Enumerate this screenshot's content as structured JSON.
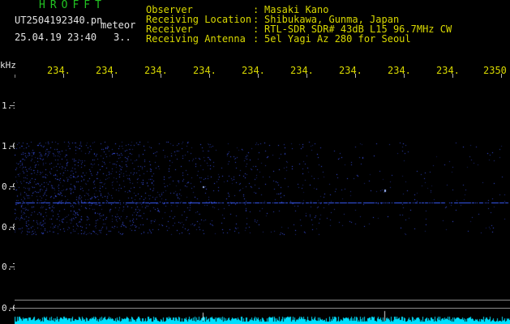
{
  "app": {
    "title": "HROFFT"
  },
  "file": {
    "name": "UT2504192340.pn",
    "mode": "meteor",
    "datetime": "25.04.19 23:40",
    "count": "3.."
  },
  "meta": [
    {
      "label": "Observer",
      "value": "Masaki Kano"
    },
    {
      "label": "Receiving Location",
      "value": "Shibukawa, Gunma, Japan"
    },
    {
      "label": "Receiver",
      "value": "RTL-SDR SDR# 43dB L15 96.7MHz CW"
    },
    {
      "label": "Receiving Antenna",
      "value": "5el Yagi Az 280 for Seoul"
    }
  ],
  "colon": ":",
  "y_unit": "kHz",
  "x_ticks": [
    "234.",
    "234.",
    "234.",
    "234.",
    "234.",
    "234.",
    "234.",
    "234.",
    "234.",
    "2350"
  ],
  "y_ticks": [
    "1.1",
    "1.0",
    "0.9",
    "0.8",
    "0.7",
    "0.6"
  ],
  "colors": {
    "title": "#22c322",
    "meta": "#d8d800",
    "text": "#e4e4e4",
    "signal": "#3a5cff",
    "noise_bar": "#00e0ff",
    "background": "#000000"
  },
  "spectrogram": {
    "carrier_khz": 0.86,
    "noise_band_khz": [
      0.78,
      1.01
    ],
    "noise_fade": "left-to-right"
  }
}
